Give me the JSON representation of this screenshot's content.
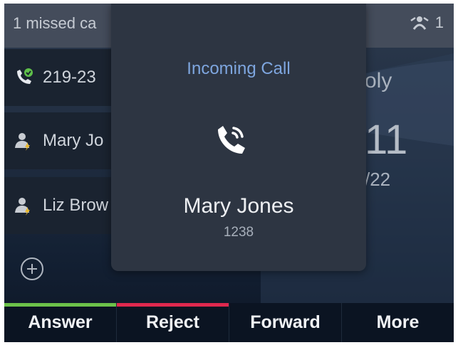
{
  "status_bar": {
    "missed_calls": "1 missed ca",
    "right_count": "1"
  },
  "call_list": [
    {
      "label": "219-23",
      "icon": "phone-check-icon"
    },
    {
      "label": "Mary Jo",
      "icon": "contact-person-icon"
    },
    {
      "label": "Liz Brow",
      "icon": "contact-person-icon"
    }
  ],
  "background_fragments": {
    "partial_word": "oly",
    "time_partial": "11",
    "date_partial": "/22"
  },
  "popup": {
    "title": "Incoming Call",
    "caller_name": "Mary Jones",
    "caller_number": "1238",
    "icon": "incoming-call-icon"
  },
  "softkeys": [
    {
      "label": "Answer",
      "accent": "#6cc24a"
    },
    {
      "label": "Reject",
      "accent": "#e0284e"
    },
    {
      "label": "Forward",
      "accent": ""
    },
    {
      "label": "More",
      "accent": ""
    }
  ],
  "colors": {
    "popup_title": "#7ea6df",
    "answer": "#6cc24a",
    "reject": "#e0284e"
  }
}
